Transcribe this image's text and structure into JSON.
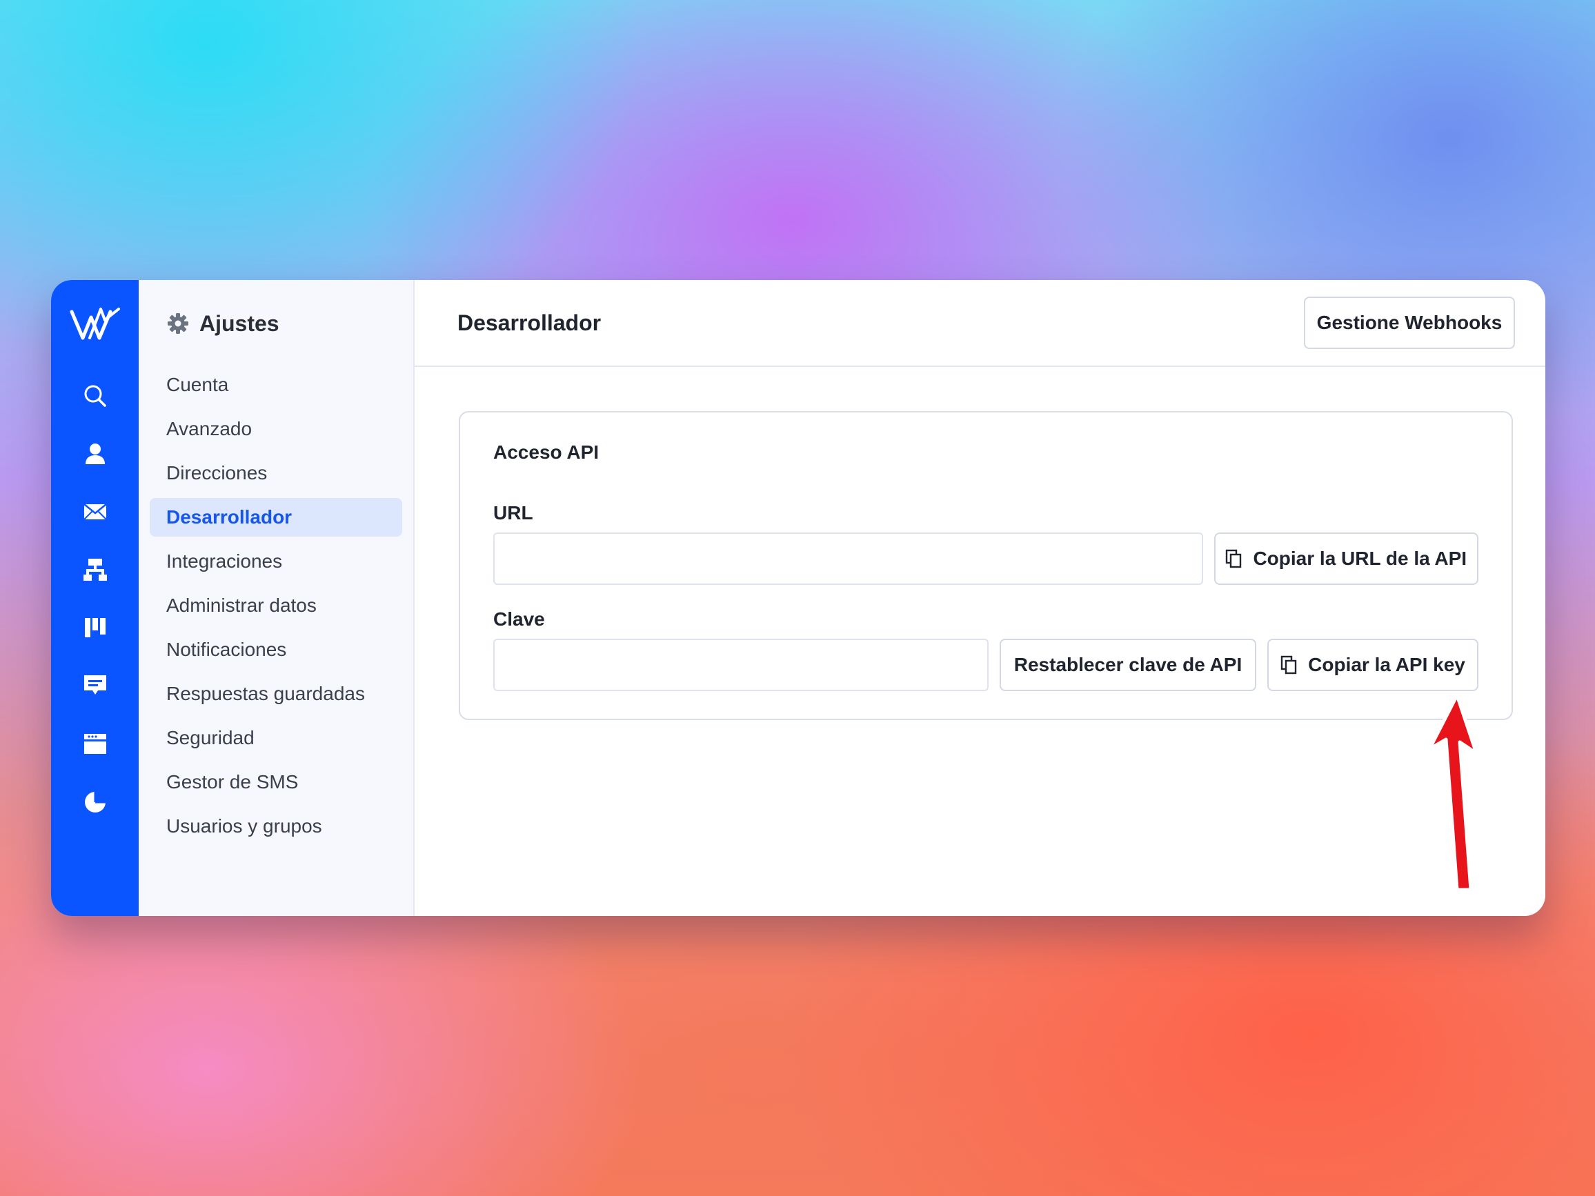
{
  "rail": {
    "items": [
      {
        "icon": "search-icon"
      },
      {
        "icon": "person-icon"
      },
      {
        "icon": "mail-icon"
      },
      {
        "icon": "org-chart-icon"
      },
      {
        "icon": "kanban-icon"
      },
      {
        "icon": "chat-icon"
      },
      {
        "icon": "calendar-icon"
      },
      {
        "icon": "pie-chart-icon"
      }
    ]
  },
  "settings": {
    "title": "Ajustes",
    "items": [
      {
        "label": "Cuenta",
        "active": false
      },
      {
        "label": "Avanzado",
        "active": false
      },
      {
        "label": "Direcciones",
        "active": false
      },
      {
        "label": "Desarrollador",
        "active": true
      },
      {
        "label": "Integraciones",
        "active": false
      },
      {
        "label": "Administrar datos",
        "active": false
      },
      {
        "label": "Notificaciones",
        "active": false
      },
      {
        "label": "Respuestas guardadas",
        "active": false
      },
      {
        "label": "Seguridad",
        "active": false
      },
      {
        "label": "Gestor de SMS",
        "active": false
      },
      {
        "label": "Usuarios y grupos",
        "active": false
      }
    ]
  },
  "main": {
    "title": "Desarrollador",
    "webhooks_button": "Gestione Webhooks",
    "card": {
      "title": "Acceso API",
      "url_label": "URL",
      "url_value": "",
      "copy_url_button": "Copiar la URL de la API",
      "key_label": "Clave",
      "key_value": "",
      "reset_key_button": "Restablecer clave de API",
      "copy_key_button": "Copiar la API key"
    }
  },
  "colors": {
    "rail": "#0a55ff",
    "active_nav_bg": "#dce6fd",
    "active_nav_text": "#1757e8",
    "annotation_arrow": "#e8141c"
  }
}
